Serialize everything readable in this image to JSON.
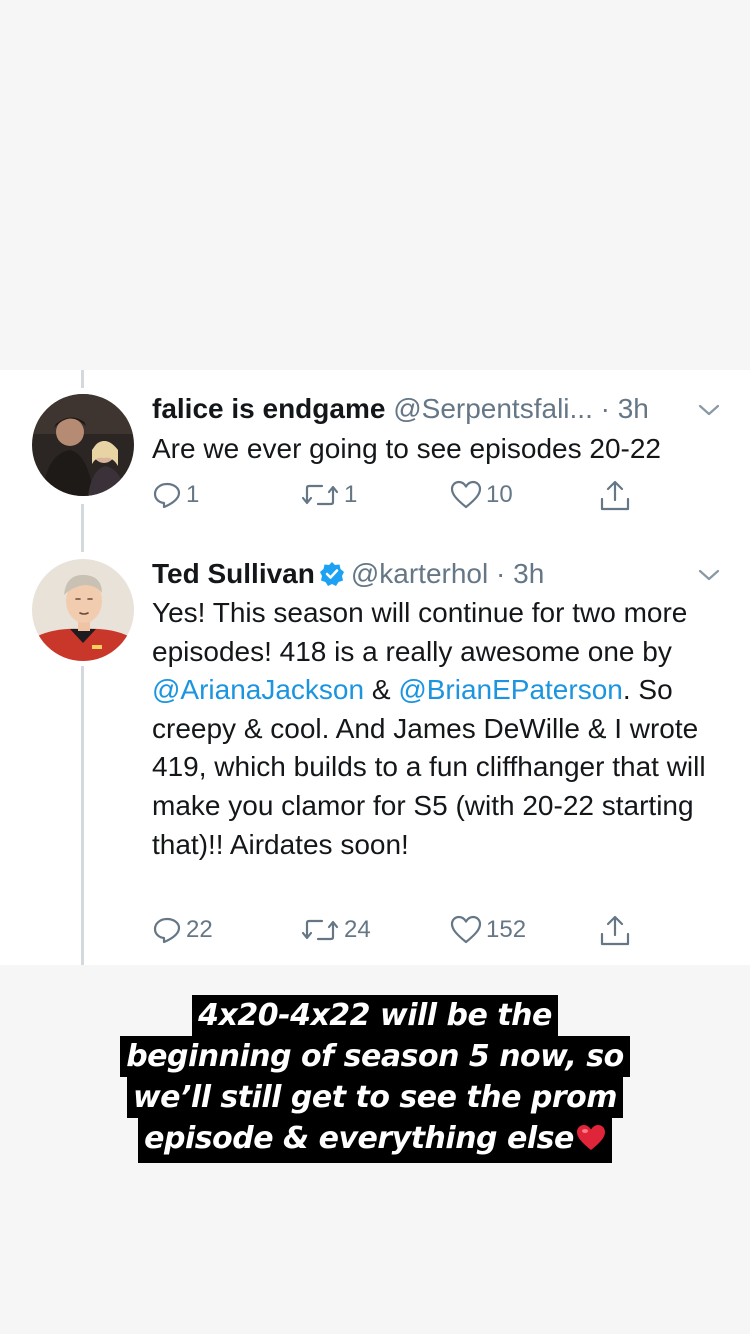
{
  "tweets": [
    {
      "name": "falice is endgame",
      "handle": "@Serpentsfali...",
      "separator": "·",
      "time": "3h",
      "text": "Are we ever going to see episodes 20-22",
      "replies": "1",
      "retweets": "1",
      "likes": "10"
    },
    {
      "name": "Ted Sullivan",
      "handle": "@karterhol",
      "separator": "·",
      "time": "3h",
      "verified": true,
      "text_parts": [
        "Yes! This season will continue for two more episodes! 418 is a really awesome one by ",
        "@ArianaJackson",
        " & ",
        "@BrianEPaterson",
        ". So creepy & cool. And James DeWille & I wrote 419, which builds to a fun cliffhanger that will make you clamor for S5 (with 20-22 starting that)!! Airdates soon!"
      ],
      "replies": "22",
      "retweets": "24",
      "likes": "152"
    }
  ],
  "caption_lines": [
    "4x20-4x22 will be the",
    "beginning of season 5 now, so",
    "we’ll still get to see the prom",
    "episode & everything else"
  ],
  "icons": {
    "reply": "reply-icon",
    "retweet": "retweet-icon",
    "like": "heart-icon",
    "share": "share-icon",
    "caret": "chevron-down-icon",
    "verified": "verified-badge-icon",
    "emoji": "red-heart-emoji-icon"
  },
  "colors": {
    "link": "#1b95e0",
    "verified": "#1da1f2",
    "muted": "#657786",
    "heart_emoji": "#e0243a"
  }
}
